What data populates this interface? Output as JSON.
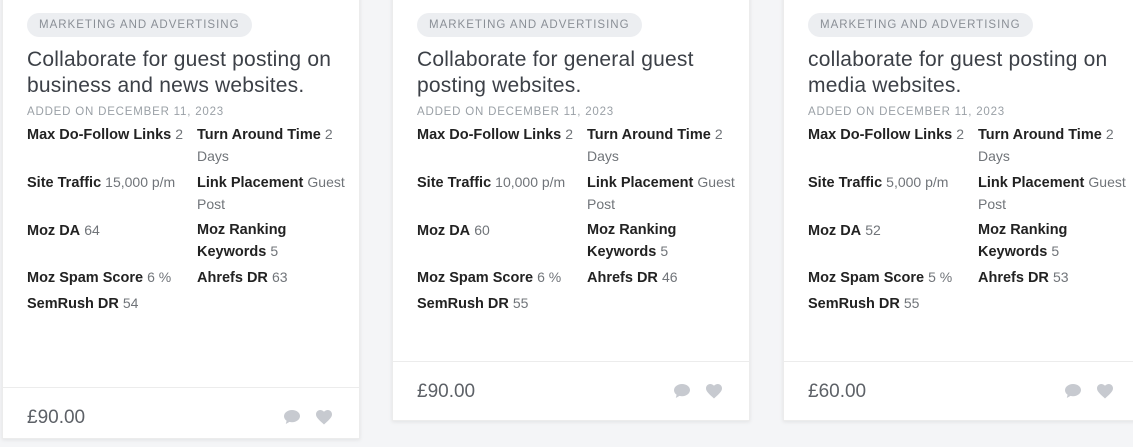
{
  "cards": [
    {
      "category": "MARKETING AND ADVERTISING",
      "title": "Collaborate for guest posting on business and news websites.",
      "added": "ADDED ON DECEMBER 11, 2023",
      "stats": [
        {
          "label": "Max Do-Follow Links",
          "value": "2"
        },
        {
          "label": "Turn Around Time",
          "value": "2 Days"
        },
        {
          "label": "Site Traffic",
          "value": "15,000 p/m"
        },
        {
          "label": "Link Placement",
          "value": "Guest Post"
        },
        {
          "label": "Moz DA",
          "value": "64"
        },
        {
          "label": "Moz Ranking Keywords",
          "value": "5"
        },
        {
          "label": "Moz Spam Score",
          "value": "6 %"
        },
        {
          "label": "Ahrefs DR",
          "value": "63"
        },
        {
          "label": "SemRush DR",
          "value": "54"
        }
      ],
      "price": "£90.00"
    },
    {
      "category": "MARKETING AND ADVERTISING",
      "title": "Collaborate for general guest posting websites.",
      "added": "ADDED ON DECEMBER 11, 2023",
      "stats": [
        {
          "label": "Max Do-Follow Links",
          "value": "2"
        },
        {
          "label": "Turn Around Time",
          "value": "2 Days"
        },
        {
          "label": "Site Traffic",
          "value": "10,000 p/m"
        },
        {
          "label": "Link Placement",
          "value": "Guest Post"
        },
        {
          "label": "Moz DA",
          "value": "60"
        },
        {
          "label": "Moz Ranking Keywords",
          "value": "5"
        },
        {
          "label": "Moz Spam Score",
          "value": "6 %"
        },
        {
          "label": "Ahrefs DR",
          "value": "46"
        },
        {
          "label": "SemRush DR",
          "value": "55"
        }
      ],
      "price": "£90.00"
    },
    {
      "category": "MARKETING AND ADVERTISING",
      "title": "collaborate for guest posting on media websites.",
      "added": "ADDED ON DECEMBER 11, 2023",
      "stats": [
        {
          "label": "Max Do-Follow Links",
          "value": "2"
        },
        {
          "label": "Turn Around Time",
          "value": "2 Days"
        },
        {
          "label": "Site Traffic",
          "value": "5,000 p/m"
        },
        {
          "label": "Link Placement",
          "value": "Guest Post"
        },
        {
          "label": "Moz DA",
          "value": "52"
        },
        {
          "label": "Moz Ranking Keywords",
          "value": "5"
        },
        {
          "label": "Moz Spam Score",
          "value": "5 %"
        },
        {
          "label": "Ahrefs DR",
          "value": "53"
        },
        {
          "label": "SemRush DR",
          "value": "55"
        }
      ],
      "price": "£60.00"
    }
  ],
  "icons": {
    "comment": "comment-icon",
    "like": "heart-icon"
  },
  "colors": {
    "icon": "#c7cad0",
    "category_bg": "#eceef1"
  }
}
